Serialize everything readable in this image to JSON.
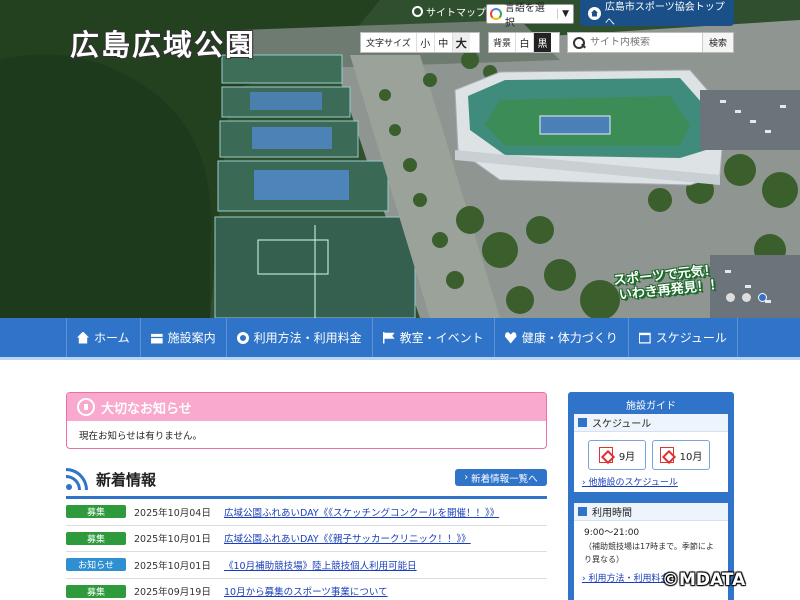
{
  "header": {
    "site_title": "広島広域公園",
    "sitemap_label": "サイトマップ",
    "language_label": "言語を選択",
    "language_caret": "▼",
    "association_link": "広島市スポーツ協会トップへ",
    "font_size": {
      "label": "文字サイズ",
      "options": [
        "小",
        "中",
        "大"
      ],
      "selected": "大"
    },
    "background": {
      "label": "背景",
      "options": [
        "白",
        "黒"
      ]
    },
    "search": {
      "placeholder": "サイト内検索",
      "button": "検索"
    },
    "slogan_line1": "スポーツで元気！",
    "slogan_line2": "いわき再発見！！",
    "slide_count": 3,
    "slide_active": 3
  },
  "nav": {
    "items": [
      {
        "label": "ホーム",
        "icon": "home-icon"
      },
      {
        "label": "施設案内",
        "icon": "building-icon"
      },
      {
        "label": "利用方法・利用料金",
        "icon": "gear-icon"
      },
      {
        "label": "教室・イベント",
        "icon": "flag-icon"
      },
      {
        "label": "健康・体力づくり",
        "icon": "heart-icon"
      },
      {
        "label": "スケジュール",
        "icon": "calendar-icon"
      }
    ]
  },
  "notice": {
    "title": "大切なお知らせ",
    "body": "現在お知らせは有りません。"
  },
  "news": {
    "title": "新着情報",
    "more_button": "新着情報一覧へ",
    "rows": [
      {
        "badge": "募集",
        "badge_color": "#2e9a3c",
        "date": "2025年10月04日",
        "text": "広域公園ふれあいDAY《《スケッチングコンクールを開催！！》》"
      },
      {
        "badge": "募集",
        "badge_color": "#2e9a3c",
        "date": "2025年10月01日",
        "text": "広域公園ふれあいDAY《《親子サッカークリニック！！》》"
      },
      {
        "badge": "お知らせ",
        "badge_color": "#2f8fd3",
        "date": "2025年10月01日",
        "text": "《10月補助競技場》陸上競技個人利用可能日"
      },
      {
        "badge": "募集",
        "badge_color": "#2e9a3c",
        "date": "2025年09月19日",
        "text": "10月から募集のスポーツ事業について"
      }
    ]
  },
  "side": {
    "title": "施設ガイド",
    "schedule_heading": "スケジュール",
    "months": [
      "9月",
      "10月"
    ],
    "other_schedule_link": "他施設のスケジュール",
    "hours_heading": "利用時間",
    "hours": "9:00～21:00",
    "hours_note": "（補助競技場は17時まで。季節により異なる）",
    "usage_link": "利用方法・利用料金"
  },
  "watermark": "©MDATA",
  "colors": {
    "nav_blue": "#2f74c8",
    "notice_pink": "#f9a9cd",
    "badge_green": "#2e9a3c",
    "badge_blue": "#2f8fd3"
  }
}
